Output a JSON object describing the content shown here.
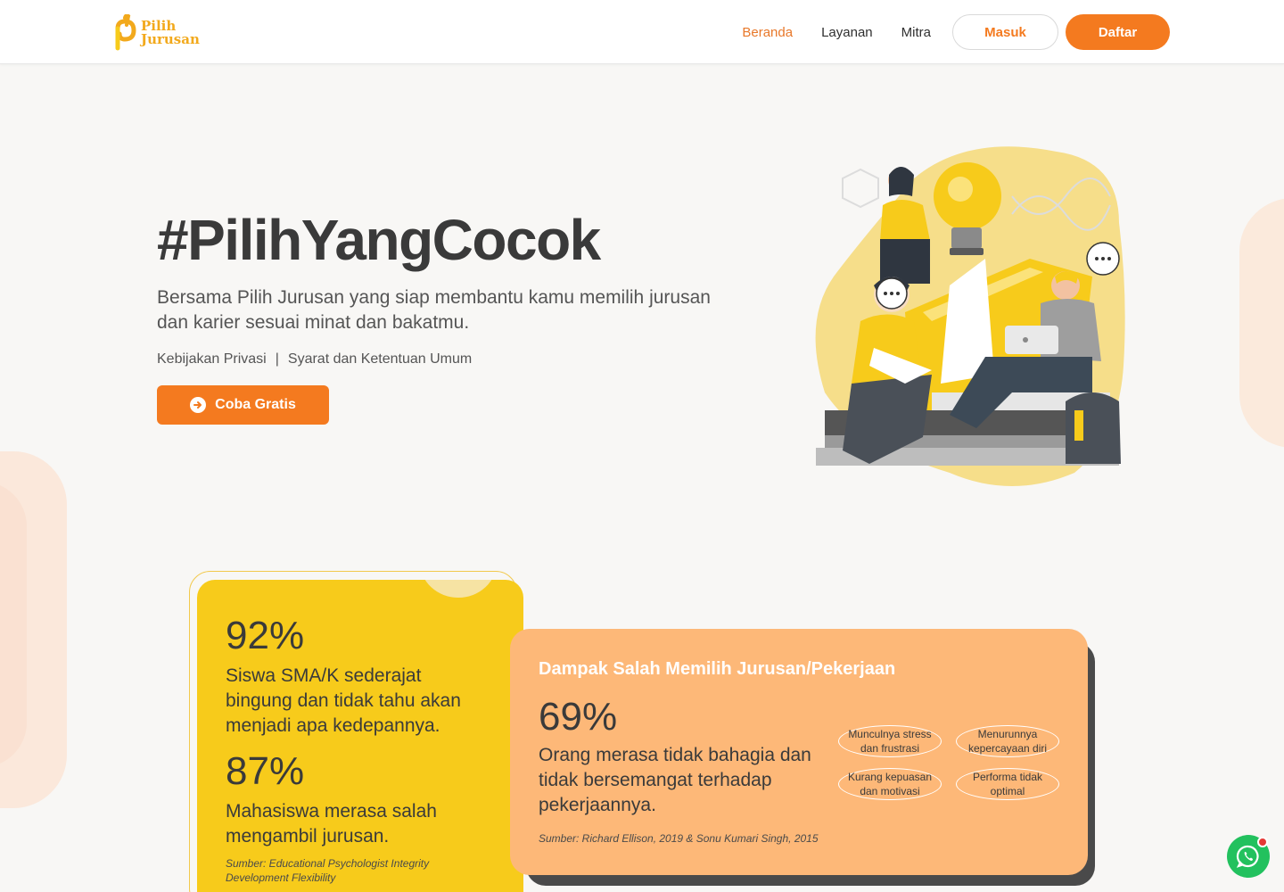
{
  "brand": {
    "line1": "Pilih",
    "line2": "Jurusan"
  },
  "nav": {
    "items": [
      {
        "label": "Beranda",
        "active": true
      },
      {
        "label": "Layanan",
        "active": false
      },
      {
        "label": "Mitra",
        "active": false
      }
    ],
    "login_label": "Masuk",
    "register_label": "Daftar"
  },
  "hero": {
    "title": "#PilihYangCocok",
    "subtitle": "Bersama Pilih Jurusan yang siap membantu kamu memilih jurusan dan karier sesuai minat dan bakatmu.",
    "privacy_link": "Kebijakan Privasi",
    "separator": "|",
    "terms_link": "Syarat dan Ketentuan Umum",
    "cta_label": "Coba Gratis"
  },
  "stats_card": {
    "stat1_value": "92%",
    "stat1_desc": "Siswa SMA/K sederajat bingung dan tidak tahu akan menjadi apa kedepannya.",
    "stat2_value": "87%",
    "stat2_desc": "Mahasiswa merasa salah mengambil jurusan.",
    "source": "Sumber: Educational Psychologist Integrity Development Flexibility"
  },
  "impact_card": {
    "title": "Dampak Salah Memilih Jurusan/Pekerjaan",
    "value": "69%",
    "desc": "Orang merasa tidak bahagia dan tidak bersemangat terhadap pekerjaannya.",
    "source": "Sumber: Richard Ellison, 2019 & Sonu Kumari Singh, 2015",
    "tags": [
      "Munculnya stress dan frustrasi",
      "Menurunnya kepercayaan diri",
      "Kurang kepuasan dan motivasi",
      "Performa tidak optimal"
    ]
  },
  "colors": {
    "accent": "#f47a1f",
    "yellow": "#f7cb1b",
    "peach": "#fdb878",
    "whatsapp": "#22c15e"
  },
  "icons": [
    "logo-mark-icon",
    "arrow-right-circle-icon",
    "whatsapp-icon"
  ]
}
